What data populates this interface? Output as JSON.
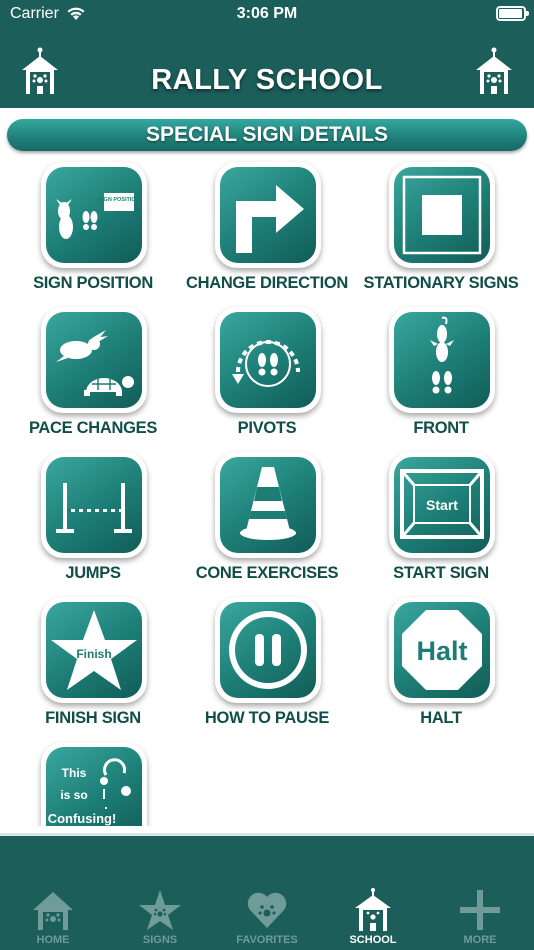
{
  "status_bar": {
    "carrier": "Carrier",
    "time": "3:06 PM"
  },
  "header": {
    "title": "RALLY SCHOOL",
    "left_icon": "schoolhouse-icon",
    "right_icon": "schoolhouse-icon"
  },
  "section": {
    "title": "SPECIAL SIGN DETAILS"
  },
  "tiles": [
    {
      "label": "SIGN POSITION",
      "icon": "sign-position-icon",
      "icon_text": "SIGN POSITION"
    },
    {
      "label": "CHANGE DIRECTION",
      "icon": "turn-arrow-icon"
    },
    {
      "label": "STATIONARY SIGNS",
      "icon": "square-icon"
    },
    {
      "label": "PACE CHANGES",
      "icon": "rabbit-turtle-icon"
    },
    {
      "label": "PIVOTS",
      "icon": "pivot-icon"
    },
    {
      "label": "FRONT",
      "icon": "dog-front-icon"
    },
    {
      "label": "JUMPS",
      "icon": "jump-icon"
    },
    {
      "label": "CONE EXERCISES",
      "icon": "cone-icon"
    },
    {
      "label": "START SIGN",
      "icon": "start-sign-icon",
      "icon_text": "Start"
    },
    {
      "label": "FINISH SIGN",
      "icon": "finish-star-icon",
      "icon_text": "Finish"
    },
    {
      "label": "HOW TO PAUSE",
      "icon": "pause-icon"
    },
    {
      "label": "HALT",
      "icon": "halt-octagon-icon",
      "icon_text": "Halt"
    },
    {
      "label": "",
      "icon": "confusing-icon",
      "icon_text_line1": "This",
      "icon_text_line2": "is so",
      "icon_text_line3": "Confusing!"
    }
  ],
  "tabbar": {
    "items": [
      {
        "label": "HOME",
        "icon": "home-icon",
        "active": false
      },
      {
        "label": "SIGNS",
        "icon": "star-icon",
        "active": false
      },
      {
        "label": "FAVORITES",
        "icon": "heart-icon",
        "active": false
      },
      {
        "label": "SCHOOL",
        "icon": "schoolhouse-icon",
        "active": true
      },
      {
        "label": "MORE",
        "icon": "plus-icon",
        "active": false
      }
    ]
  },
  "colors": {
    "header_bg": "#1b5e5a",
    "tile_teal": "#1c7d75",
    "label_text": "#114d49",
    "tab_inactive": "#6f9c98"
  }
}
